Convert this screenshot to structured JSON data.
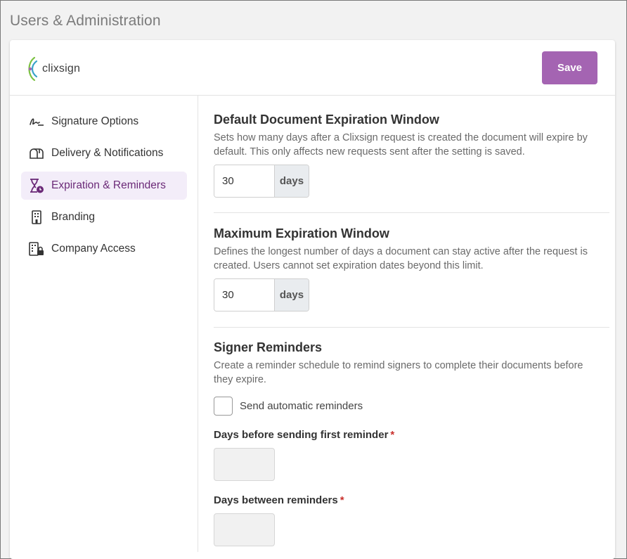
{
  "page": {
    "title": "Users & Administration"
  },
  "header": {
    "logo_text": "clixsign",
    "save_label": "Save",
    "accent_color": "#a464b2"
  },
  "sidebar": {
    "items": [
      {
        "label": "Signature Options",
        "icon": "signature-icon",
        "active": false
      },
      {
        "label": "Delivery & Notifications",
        "icon": "mailbox-icon",
        "active": false
      },
      {
        "label": "Expiration & Reminders",
        "icon": "hourglass-clock-icon",
        "active": true
      },
      {
        "label": "Branding",
        "icon": "building-icon",
        "active": false
      },
      {
        "label": "Company Access",
        "icon": "building-lock-icon",
        "active": false
      }
    ]
  },
  "main": {
    "default_expiration": {
      "title": "Default Document Expiration Window",
      "description": "Sets how many days after a Clixsign request is created the document will expire by default. This only affects new requests sent after the setting is saved.",
      "value": "30",
      "unit": "days"
    },
    "max_expiration": {
      "title": "Maximum Expiration Window",
      "description": "Defines the longest number of days a document can stay active after the request is created. Users cannot set expiration dates beyond this limit.",
      "value": "30",
      "unit": "days"
    },
    "reminders": {
      "title": "Signer Reminders",
      "description": "Create a reminder schedule to remind signers to complete their documents before they expire.",
      "auto_label": "Send automatic reminders",
      "auto_checked": false,
      "first_reminder_label": "Days before sending first reminder",
      "between_label": "Days between reminders",
      "required_marker": "*"
    }
  }
}
